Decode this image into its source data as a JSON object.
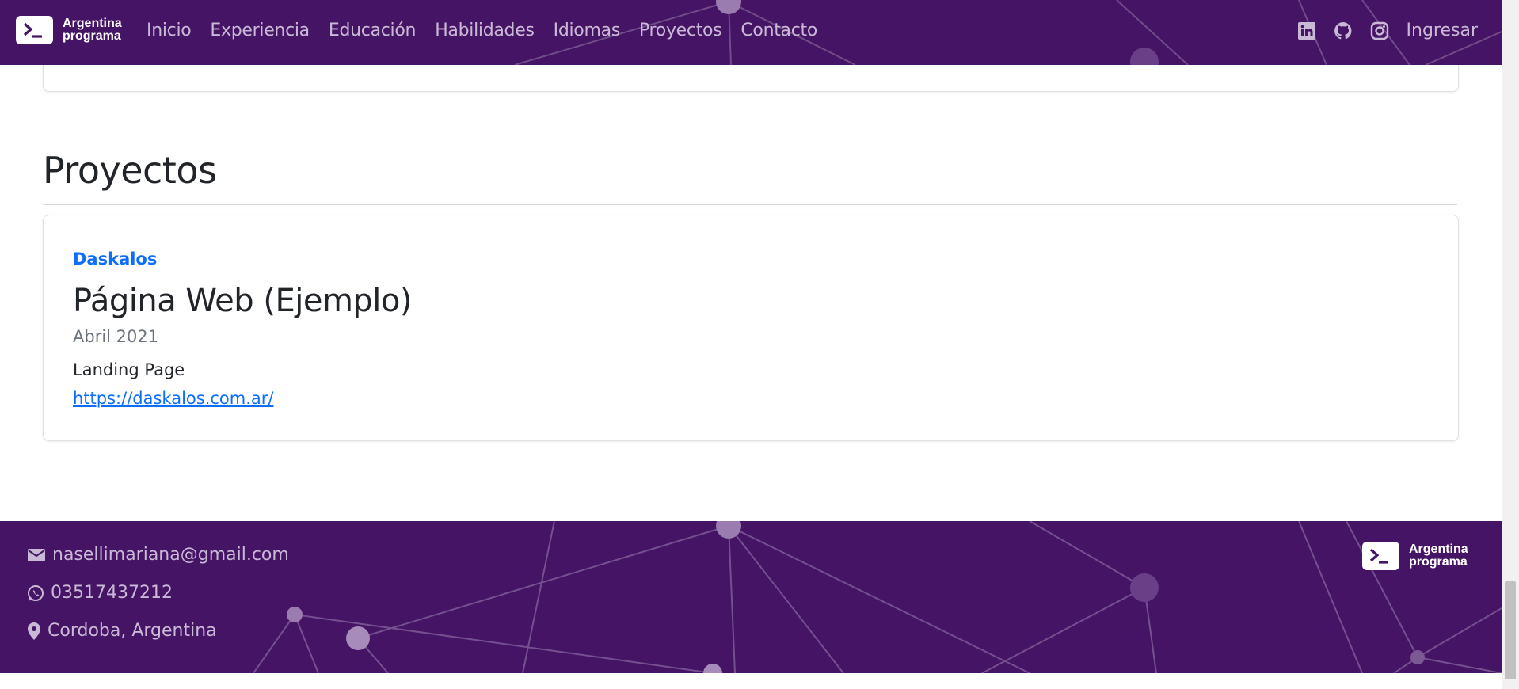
{
  "brand": {
    "line1": "Argentina",
    "line2": "programa",
    "bg_color": "#451464"
  },
  "nav": {
    "links": [
      "Inicio",
      "Experiencia",
      "Educación",
      "Habilidades",
      "Idiomas",
      "Proyectos",
      "Contacto"
    ],
    "icons": [
      "linkedin-icon",
      "github-icon",
      "instagram-icon"
    ],
    "login_label": "Ingresar"
  },
  "projects": {
    "title": "Proyectos",
    "item": {
      "company": "Daskalos",
      "name": "Página Web (Ejemplo)",
      "date": "Abril 2021",
      "description": "Landing Page",
      "url": "https://daskalos.com.ar/"
    }
  },
  "footer": {
    "email": "nasellimariana@gmail.com",
    "phone": "03517437212",
    "location": "Cordoba, Argentina",
    "icons": [
      "envelope-icon",
      "whatsapp-icon",
      "map-pin-icon"
    ]
  },
  "colors": {
    "accent": "#0d6efd",
    "muted": "#6c757d",
    "nav_text": "#c9b9d6"
  }
}
